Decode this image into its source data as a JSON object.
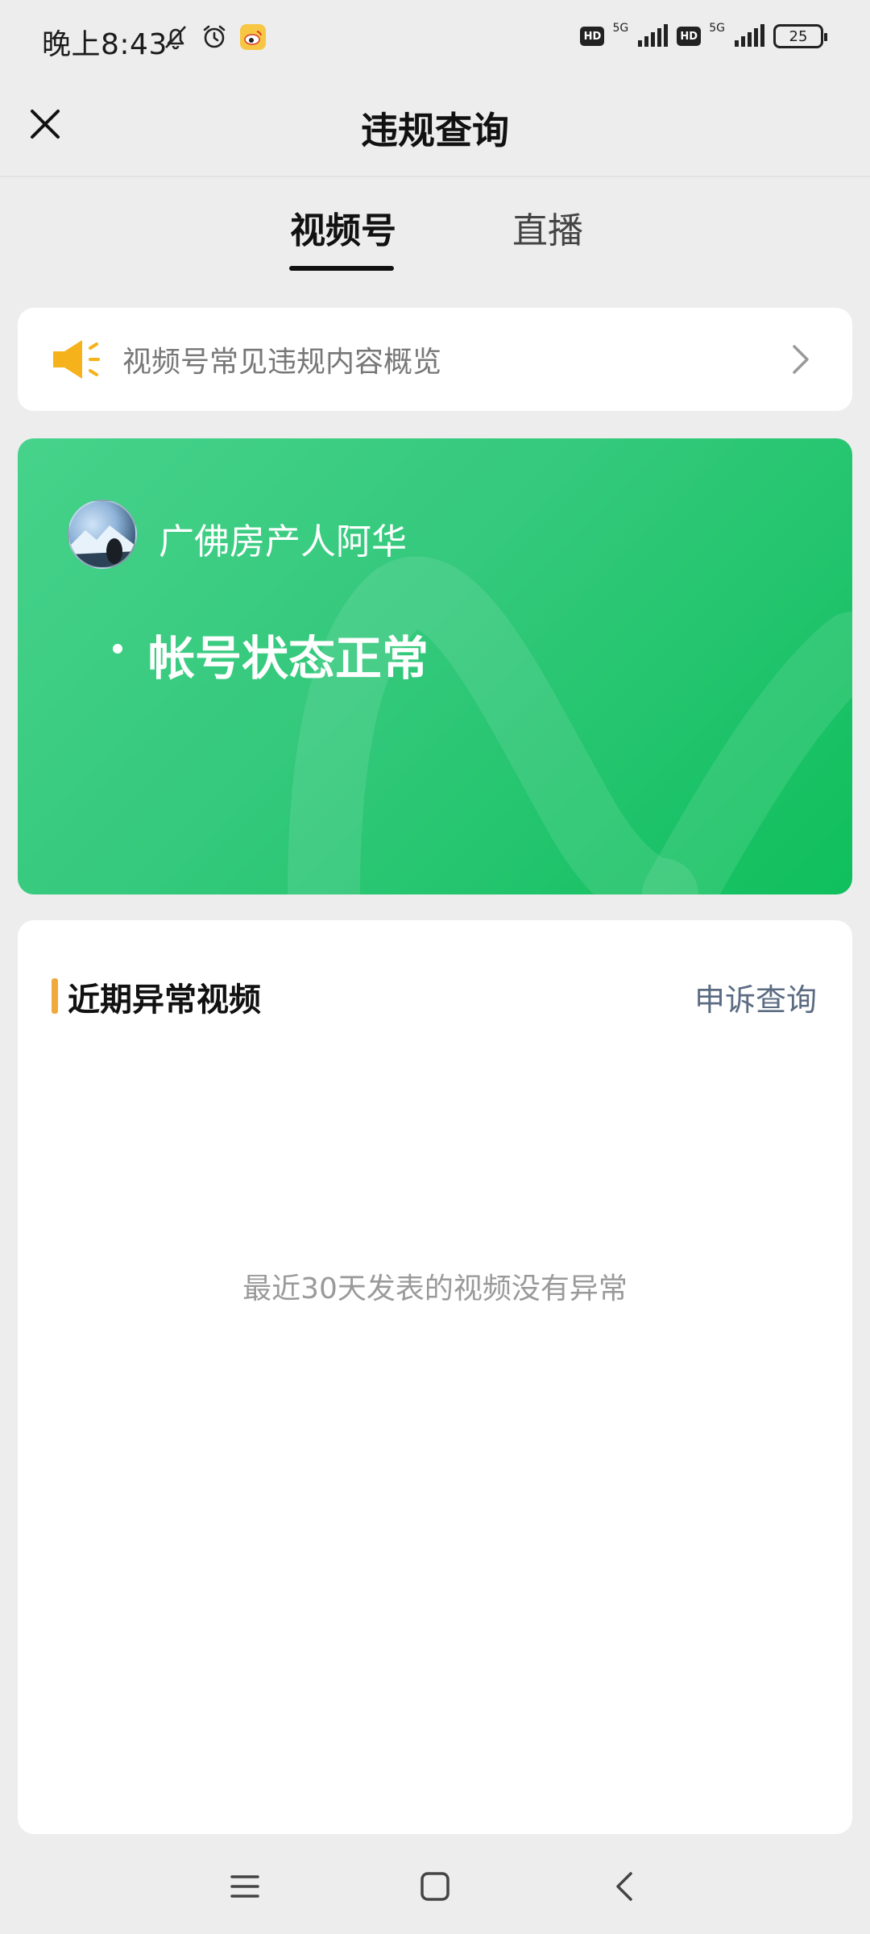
{
  "status_bar": {
    "time": "晚上8:43",
    "network_1": "5G",
    "network_2": "5G",
    "hd_label": "HD",
    "battery": "25"
  },
  "header": {
    "title": "违规查询",
    "close_icon": "close-icon"
  },
  "tabs": [
    {
      "label": "视频号",
      "active": true
    },
    {
      "label": "直播",
      "active": false
    }
  ],
  "notice": {
    "icon": "megaphone-icon",
    "text": "视频号常见违规内容概览",
    "arrow": "chevron-right-icon"
  },
  "account_card": {
    "name": "广佛房产人阿华",
    "status": "帐号状态正常"
  },
  "recent_videos": {
    "title": "近期异常视频",
    "appeal_label": "申诉查询",
    "empty_message": "最近30天发表的视频没有异常"
  },
  "colors": {
    "accent_green": "#34c97c",
    "section_marker": "#f0a93b",
    "link": "#5b6b82"
  }
}
